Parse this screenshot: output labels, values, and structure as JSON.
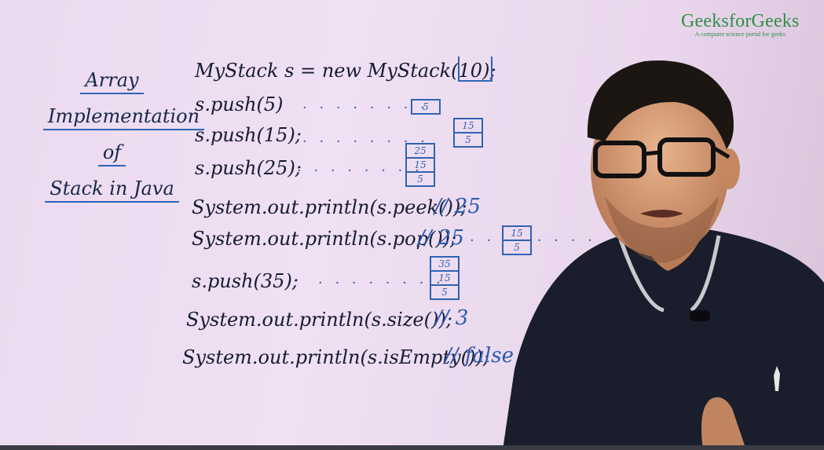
{
  "logo": {
    "brand": "GeeksforGeeks",
    "tagline": "A computer science portal for geeks"
  },
  "title": {
    "line1": "Array",
    "line2": "Implementation",
    "line3": "of",
    "line4": "Stack in Java"
  },
  "code": {
    "line1": "MyStack s = new MyStack(10);",
    "line2": "s.push(5)",
    "line3": "s.push(15);",
    "line4": "s.push(25);",
    "line5": "System.out.println(s.peek());",
    "line6": "System.out.println(s.pop());",
    "line7": "s.push(35);",
    "line8": "System.out.println(s.size());",
    "line9": "System.out.println(s.isEmpty());"
  },
  "dots": "· · · · · · · ·",
  "comments": {
    "peek": "// 25",
    "pop": "// 25",
    "size": "// 3",
    "isEmpty": "// false"
  },
  "stacks": {
    "push5": [
      "5"
    ],
    "push15": [
      "15",
      "5"
    ],
    "push25": [
      "25",
      "15",
      "5"
    ],
    "pop": [
      "15",
      "5"
    ],
    "push35": [
      "35",
      "15",
      "5"
    ]
  },
  "colors": {
    "board": "#ecdaf0",
    "marker_blue": "#2e63b5",
    "marker_black": "#141c34",
    "logo_green": "#2f8d46",
    "shirt": "#1a1d2b"
  }
}
